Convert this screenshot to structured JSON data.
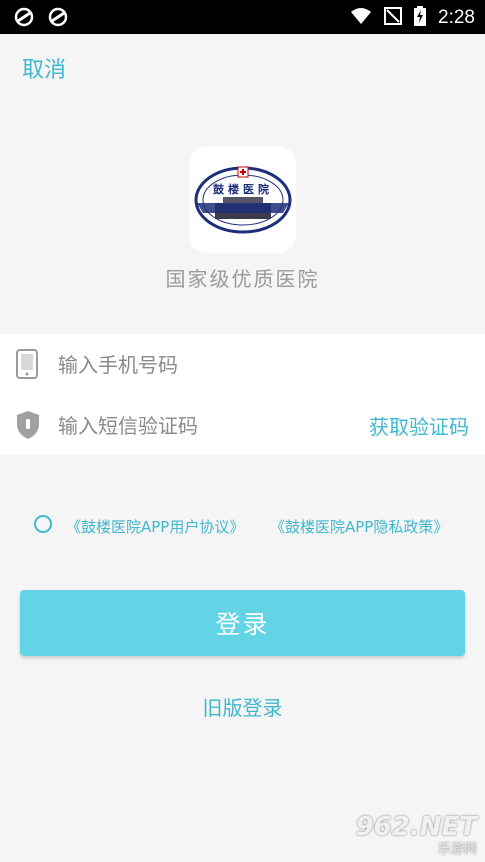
{
  "status_bar": {
    "time": "2:28"
  },
  "header": {
    "cancel_label": "取消"
  },
  "logo": {
    "emblem_text": "鼓楼医院",
    "tagline": "国家级优质医院"
  },
  "form": {
    "phone_placeholder": "输入手机号码",
    "code_placeholder": "输入短信验证码",
    "get_code_label": "获取验证码"
  },
  "agreement": {
    "checked": false,
    "user_agreement": "《鼓楼医院APP用户协议》",
    "privacy_policy": "《鼓楼医院APP隐私政策》"
  },
  "actions": {
    "login_label": "登录",
    "old_login_label": "旧版登录"
  },
  "watermark": {
    "number": "962.NET",
    "site": "乐游网"
  },
  "colors": {
    "accent": "#3fb8cf",
    "button": "#62d4e6",
    "background": "#f5f5f5"
  }
}
